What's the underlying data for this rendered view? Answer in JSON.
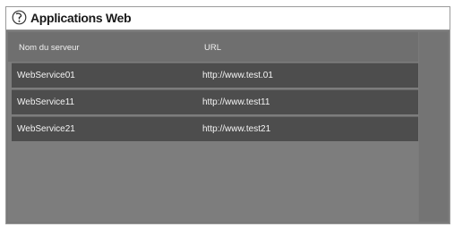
{
  "window": {
    "title": "Applications Web",
    "icon": "globe-info-icon"
  },
  "table": {
    "columns": [
      "Nom du serveur",
      "URL"
    ],
    "rows": [
      {
        "server": "WebService01",
        "url": "http://www.test.01"
      },
      {
        "server": "WebService11",
        "url": "http://www.test11"
      },
      {
        "server": "WebService21",
        "url": "http://www.test21"
      }
    ]
  },
  "colors": {
    "window_bg": "#7a7a7a",
    "row_bg": "#4d4d4d",
    "text": "#f4f4f4"
  }
}
